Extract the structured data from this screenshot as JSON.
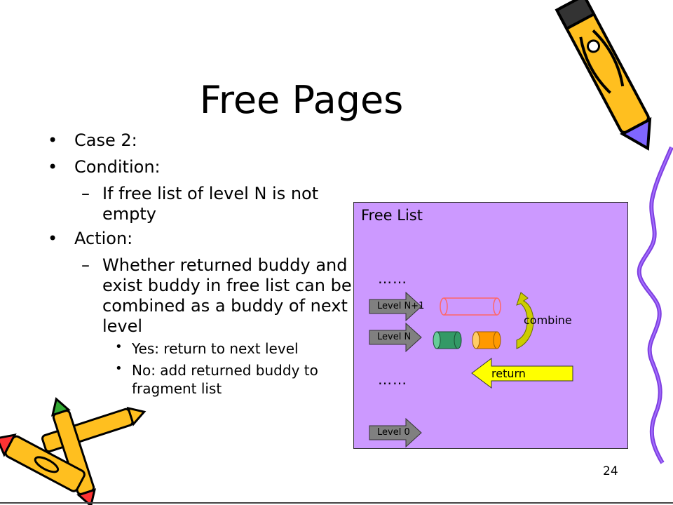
{
  "slide": {
    "title": "Free Pages",
    "bullets": [
      {
        "marker": "•",
        "text": "Case 2:"
      },
      {
        "marker": "•",
        "text": "Condition:"
      },
      {
        "marker": "–",
        "text": "If free list of level N is not empty"
      },
      {
        "marker": "•",
        "text": "Action:"
      },
      {
        "marker": "–",
        "text": "Whether returned buddy and exist buddy in free list can be combined as a buddy of next level"
      },
      {
        "marker": "•",
        "text": "Yes: return to next level"
      },
      {
        "marker": "•",
        "text": "No: add returned buddy to fragment list"
      }
    ],
    "page_number": "24"
  },
  "diagram": {
    "title": "Free List",
    "dots_top": "……",
    "dots_bottom": "……",
    "levels": {
      "n_plus_1": "Level N+1",
      "n": "Level N",
      "zero": "Level 0"
    },
    "combine_label": "combine",
    "return_label": "return",
    "colors": {
      "panel": "#cc99ff",
      "level_arrow": "#808080",
      "buddy_green": "#339966",
      "buddy_orange": "#ff9900",
      "combined_outline": "#ff6666",
      "combine_arrow": "#cccc00",
      "return_arrow": "#ffff00"
    }
  },
  "decorations": {
    "top_right": "crayon-pencil-icon",
    "bottom_left": "crayons-icon",
    "right_edge": "purple-ribbon-icon"
  }
}
